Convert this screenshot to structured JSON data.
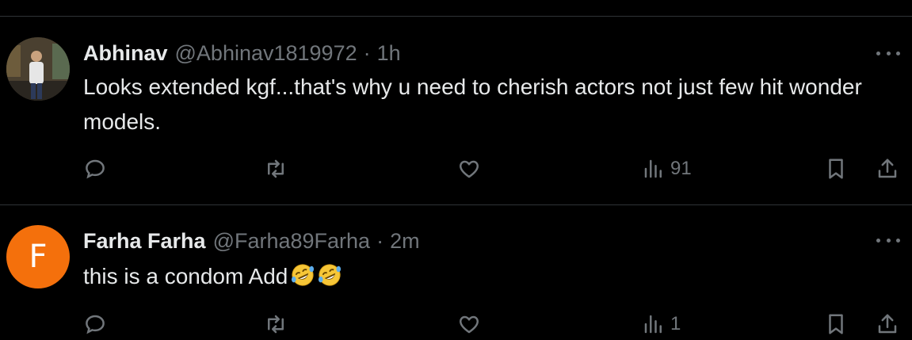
{
  "tweets": [
    {
      "name": "Abhinav",
      "handle": "@Abhinav1819972",
      "separator": "·",
      "time": "1h",
      "text": "Looks extended kgf...that's why u need to cherish actors not just few hit wonder models.",
      "views": "91",
      "avatar_type": "photo"
    },
    {
      "name": "Farha Farha",
      "handle": "@Farha89Farha",
      "separator": "·",
      "time": "2m",
      "text": "this is a condom Add",
      "emoji": [
        "rolling-on-floor-laughing-emoji",
        "rolling-on-floor-laughing-emoji"
      ],
      "views": "1",
      "avatar_letter": "F",
      "avatar_color": "#f4700c"
    }
  ],
  "colors": {
    "background": "#000000",
    "text_primary": "#e7e9ea",
    "text_secondary": "#71767b",
    "divider": "#2f3336"
  },
  "icons": [
    "reply-icon",
    "retweet-icon",
    "like-icon",
    "views-icon",
    "bookmark-icon",
    "share-icon",
    "more-icon"
  ]
}
